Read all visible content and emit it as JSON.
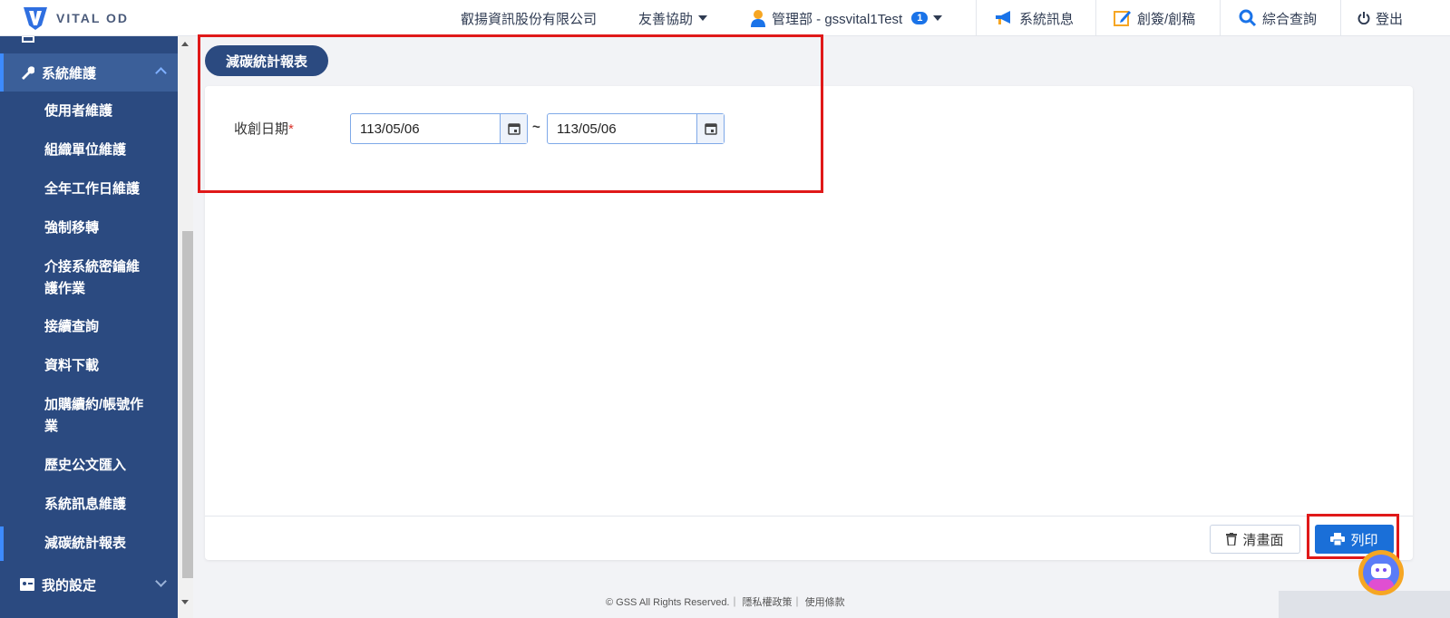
{
  "app": {
    "logo_text": "VITAL OD"
  },
  "header": {
    "company": "叡揚資訊股份有限公司",
    "help": "友善協助",
    "user": "管理部 - gssvital1Test",
    "user_badge": "1",
    "messages": "系統訊息",
    "draft": "創簽/創稿",
    "search": "綜合查詢",
    "logout": "登出"
  },
  "sidebar": {
    "group_system": "系統維護",
    "items": [
      "使用者維護",
      "組織單位維護",
      "全年工作日維護",
      "強制移轉",
      "介接系統密鑰維",
      "護作業",
      "接續查詢",
      "資料下載",
      "加購續約/帳號作",
      "業",
      "歷史公文匯入",
      "系統訊息維護",
      "減碳統計報表"
    ],
    "group_settings": "我的設定"
  },
  "main": {
    "page_tab": "減碳統計報表",
    "field_label": "收創日期",
    "required_mark": "*",
    "date_from": "113/05/06",
    "date_sep": "~",
    "date_to": "113/05/06",
    "btn_clear": "清畫面",
    "btn_print": "列印"
  },
  "footer": {
    "text": "© GSS All Rights Reserved.｜ 隱私權政策｜ 使用條款"
  },
  "colors": {
    "sidebar": "#2b4a80",
    "accent": "#1a6fd8",
    "highlight": "#e01919"
  }
}
